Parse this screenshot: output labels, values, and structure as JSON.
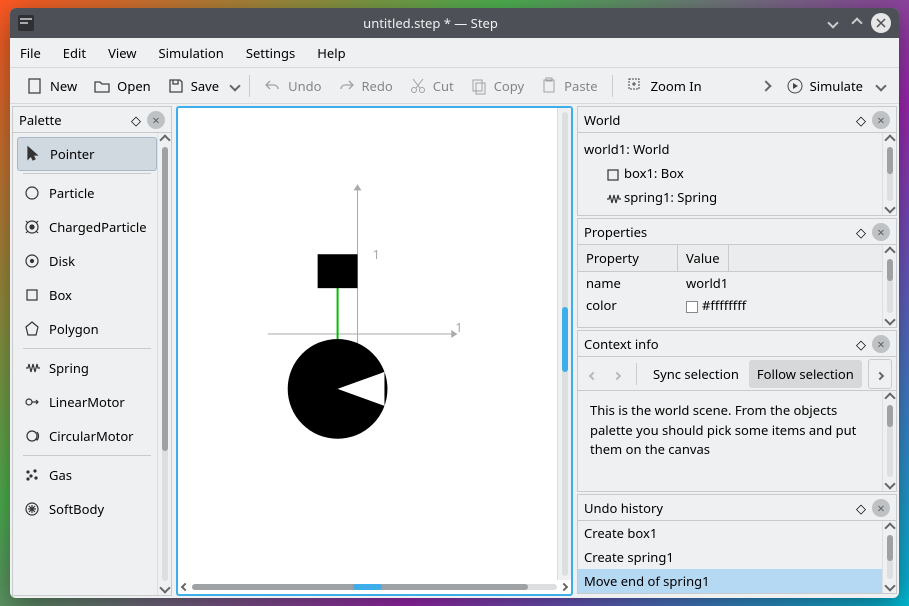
{
  "titlebar": {
    "title": "untitled.step * — Step"
  },
  "menubar": [
    "File",
    "Edit",
    "View",
    "Simulation",
    "Settings",
    "Help"
  ],
  "toolbar": {
    "new": "New",
    "open": "Open",
    "save": "Save",
    "undo": "Undo",
    "redo": "Redo",
    "cut": "Cut",
    "copy": "Copy",
    "paste": "Paste",
    "zoom_in": "Zoom In",
    "simulate": "Simulate"
  },
  "palette": {
    "title": "Palette",
    "items": [
      {
        "label": "Pointer",
        "icon": "pointer",
        "selected": true
      },
      {
        "sep": true
      },
      {
        "label": "Particle",
        "icon": "circle"
      },
      {
        "label": "ChargedParticle",
        "icon": "charged"
      },
      {
        "label": "Disk",
        "icon": "disk"
      },
      {
        "label": "Box",
        "icon": "box"
      },
      {
        "label": "Polygon",
        "icon": "polygon"
      },
      {
        "sep": true
      },
      {
        "label": "Spring",
        "icon": "spring"
      },
      {
        "label": "LinearMotor",
        "icon": "linearmotor"
      },
      {
        "label": "CircularMotor",
        "icon": "circularmotor"
      },
      {
        "sep": true
      },
      {
        "label": "Gas",
        "icon": "gas"
      },
      {
        "label": "SoftBody",
        "icon": "softbody"
      }
    ]
  },
  "canvas": {
    "axis_x_label": "1",
    "axis_y_label": "1"
  },
  "world": {
    "title": "World",
    "items": [
      {
        "label": "world1: World",
        "icon": "none",
        "indent": false
      },
      {
        "label": "box1: Box",
        "icon": "box",
        "indent": true
      },
      {
        "label": "spring1: Spring",
        "icon": "spring",
        "indent": true
      }
    ]
  },
  "properties": {
    "title": "Properties",
    "head_property": "Property",
    "head_value": "Value",
    "rows": [
      {
        "name": "name",
        "value": "world1"
      },
      {
        "name": "color",
        "value": "#ffffffff",
        "swatch": true
      }
    ]
  },
  "context": {
    "title": "Context info",
    "sync_label": "Sync selection",
    "follow_label": "Follow selection",
    "text": "This is the world scene. From the objects palette you should pick some items and put them on the canvas"
  },
  "undo": {
    "title": "Undo history",
    "items": [
      {
        "label": "Create box1"
      },
      {
        "label": "Create spring1"
      },
      {
        "label": "Move end of spring1",
        "selected": true
      }
    ]
  }
}
